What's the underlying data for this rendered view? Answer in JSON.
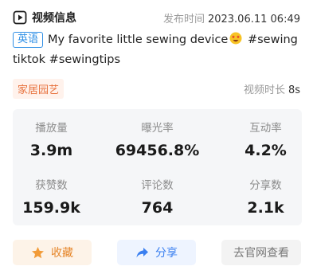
{
  "header": {
    "title": "视频信息",
    "icon": "video-icon",
    "publish_label": "发布时间",
    "publish_value": "2023.06.11 06:49"
  },
  "description": {
    "language_badge": "英语",
    "text_before_emoji": "My favorite little sewing device",
    "emoji": "star-struck-emoji",
    "text_after_emoji": " #sewing tiktok #sewingtips"
  },
  "category": {
    "tag": "家居园艺",
    "duration_label": "视频时长",
    "duration_value": "8s"
  },
  "stats": [
    {
      "label": "播放量",
      "value": "3.9m"
    },
    {
      "label": "曝光率",
      "value": "69456.8%"
    },
    {
      "label": "互动率",
      "value": "4.2%"
    },
    {
      "label": "获赞数",
      "value": "159.9k"
    },
    {
      "label": "评论数",
      "value": "764"
    },
    {
      "label": "分享数",
      "value": "2.1k"
    }
  ],
  "actions": {
    "collect_label": "收藏",
    "collect_icon": "star-icon",
    "share_label": "分享",
    "share_icon": "share-arrow-icon",
    "official_label": "去官网查看"
  },
  "colors": {
    "accent_blue": "#2f8fe6",
    "tag_orange": "#e8733f",
    "collect_orange": "#e6862a",
    "share_blue": "#3a7ff0",
    "card_bg": "#f5f6f8"
  }
}
